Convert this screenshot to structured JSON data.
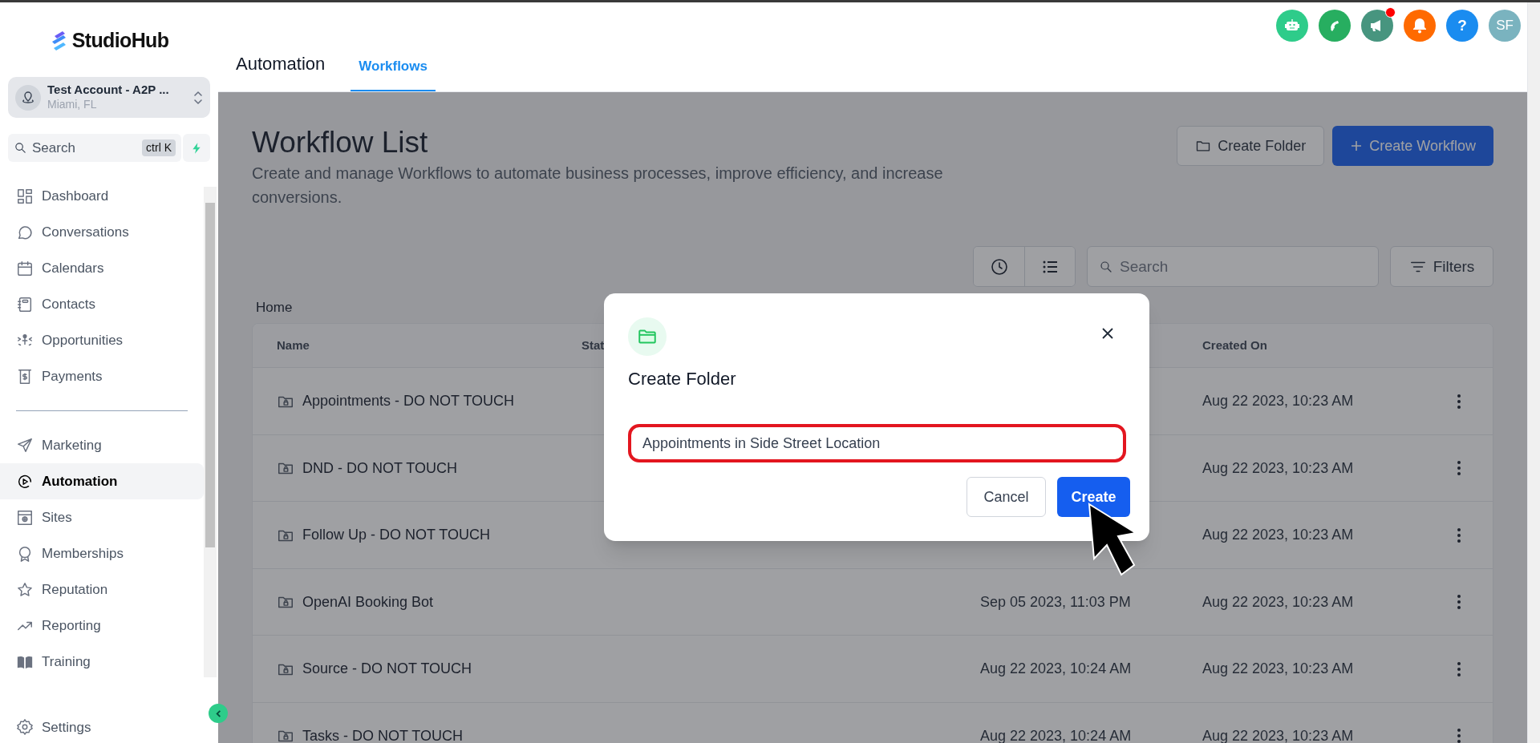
{
  "sidebar": {
    "brand": "StudioHub",
    "account": {
      "name": "Test Account - A2P ...",
      "location": "Miami, FL"
    },
    "search": {
      "placeholder": "Search",
      "shortcut": "ctrl K"
    },
    "nav_groups": [
      [
        {
          "label": "Dashboard",
          "selected": false
        },
        {
          "label": "Conversations",
          "selected": false
        },
        {
          "label": "Calendars",
          "selected": false
        },
        {
          "label": "Contacts",
          "selected": false
        },
        {
          "label": "Opportunities",
          "selected": false
        },
        {
          "label": "Payments",
          "selected": false
        }
      ],
      [
        {
          "label": "Marketing",
          "selected": false
        },
        {
          "label": "Automation",
          "selected": true
        },
        {
          "label": "Sites",
          "selected": false
        },
        {
          "label": "Memberships",
          "selected": false
        },
        {
          "label": "Reputation",
          "selected": false
        },
        {
          "label": "Reporting",
          "selected": false
        },
        {
          "label": "Training",
          "selected": false
        }
      ]
    ],
    "footer_item": {
      "label": "Settings",
      "selected": false
    }
  },
  "header": {
    "title": "Automation",
    "tabs": [
      {
        "label": "Workflows",
        "selected": true
      }
    ],
    "actions": [
      {
        "kind": "robot",
        "color": "#2ecc8a"
      },
      {
        "kind": "phone",
        "color": "#27ae60"
      },
      {
        "kind": "megaphone",
        "color": "#47957f",
        "has_notification": true
      },
      {
        "kind": "bell",
        "color": "#ff6a00"
      },
      {
        "kind": "help",
        "color": "#1a8cf0",
        "text": "?"
      },
      {
        "kind": "avatar",
        "color": "#7ab3bf",
        "text": "SF"
      }
    ]
  },
  "page": {
    "title": "Workflow List",
    "subtitle": "Create and manage Workflows to automate business processes, improve efficiency, and increase conversions.",
    "buttons": [
      {
        "label": "Create Folder",
        "kind": "secondary"
      },
      {
        "label": "Create Workflow",
        "kind": "primary"
      }
    ],
    "view_toggle": [
      {
        "kind": "recent"
      },
      {
        "kind": "list"
      }
    ],
    "search": {
      "placeholder": "Search"
    },
    "filters": "Filters",
    "breadcrumb": "Home"
  },
  "table": {
    "columns": [
      {
        "label": "Name"
      },
      {
        "label": "Stat"
      },
      {
        "label": "Created On"
      }
    ],
    "rows": [
      {
        "name": "Appointments - DO NOT TOUCH",
        "created": "Aug 22 2023, 10:23 AM"
      },
      {
        "name": "DND - DO NOT TOUCH",
        "created": "Aug 22 2023, 10:23 AM"
      },
      {
        "name": "Follow Up - DO NOT TOUCH",
        "created": "Aug 22 2023, 10:23 AM"
      },
      {
        "name": "OpenAI Booking Bot",
        "column_3": "Sep 05 2023, 11:03 PM",
        "created": "Aug 22 2023, 10:23 AM"
      },
      {
        "name": "Source - DO NOT TOUCH",
        "column_3": "Aug 22 2023, 10:24 AM",
        "created": "Aug 22 2023, 10:23 AM"
      },
      {
        "name": "Tasks - DO NOT TOUCH",
        "column_3": "Aug 22 2023, 10:24 AM",
        "created": "Aug 22 2023, 10:23 AM"
      }
    ]
  },
  "modal": {
    "title": "Create Folder",
    "value": "Appointments in Side Street Location",
    "buttons": [
      {
        "label": "Cancel",
        "kind": "secondary"
      },
      {
        "label": "Create",
        "kind": "primary"
      }
    ]
  }
}
